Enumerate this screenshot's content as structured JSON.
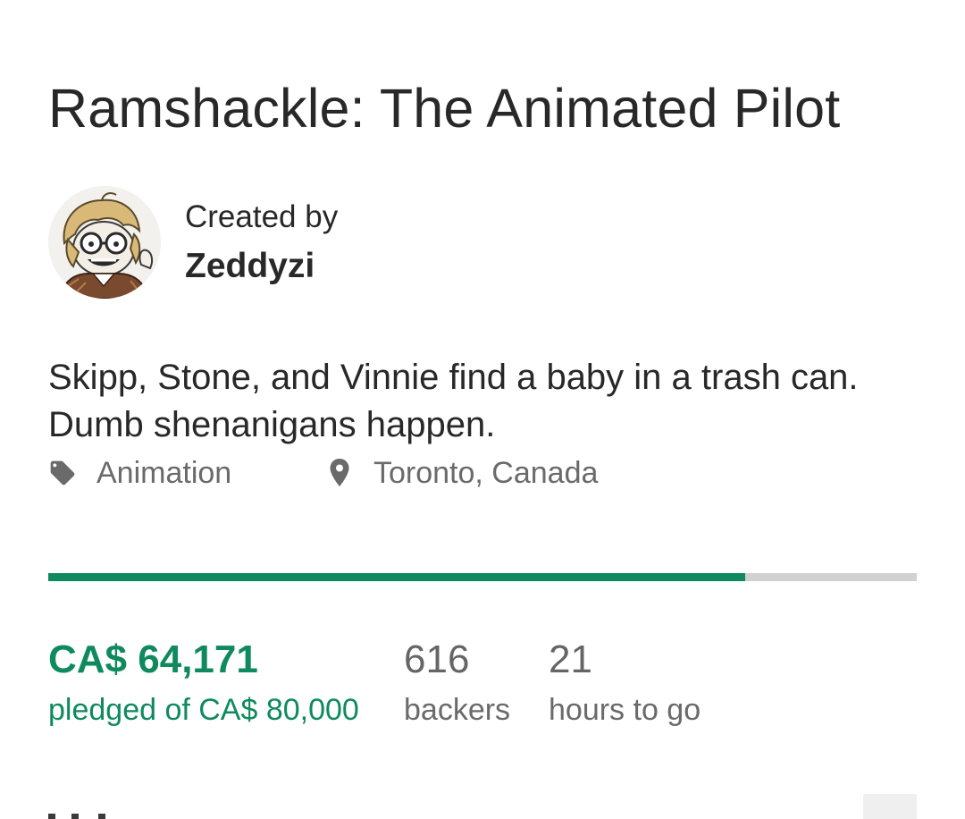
{
  "project": {
    "title": "Ramshackle: The Animated Pilot",
    "creator_prefix": "Created by",
    "creator_name": "Zeddyzi",
    "blurb": "Skipp, Stone, and Vinnie find a baby in a trash can. Dumb shenanigans happen.",
    "category": "Animation",
    "category_icon": "tag-icon",
    "location": "Toronto, Canada",
    "location_icon": "location-pin-icon"
  },
  "funding": {
    "progress_fraction": 0.802,
    "pledged_amount": "CA$ 64,171",
    "pledged_label": "pledged of CA$ 80,000",
    "backers_count": "616",
    "backers_label": "backers",
    "time_left": "21",
    "time_left_label": "hours to go"
  },
  "colors": {
    "accent": "#0f8a5f",
    "track": "#d1d1d1",
    "text": "#282828",
    "muted": "#6a6a6a"
  }
}
